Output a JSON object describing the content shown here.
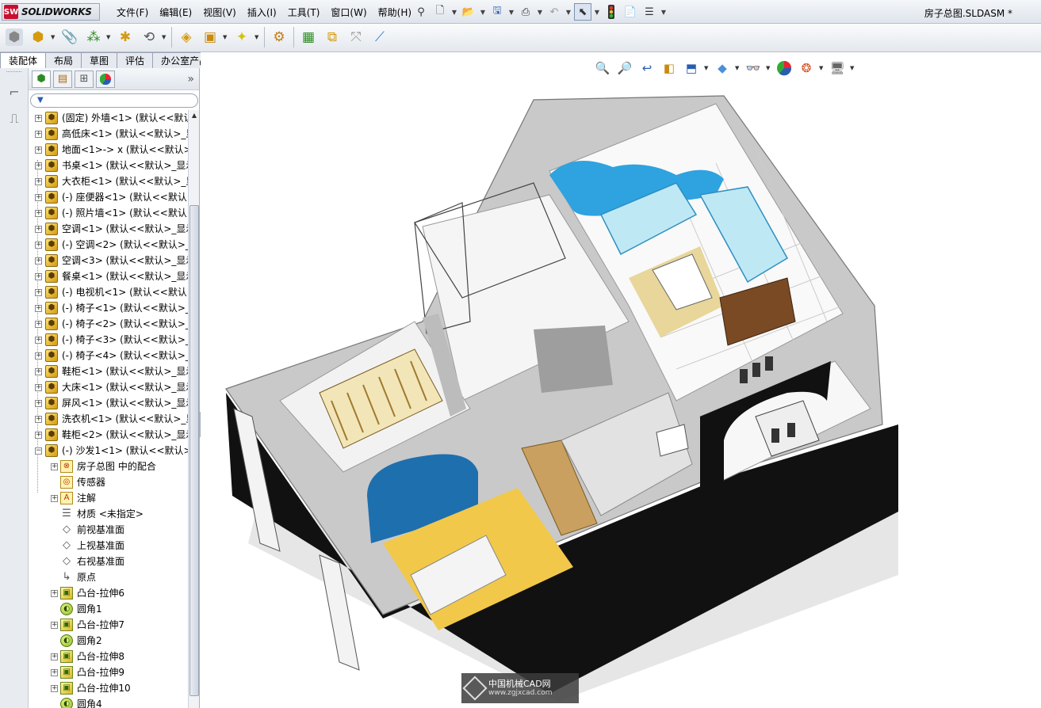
{
  "app": {
    "logo_badge": "SW",
    "logo_text": "SOLIDWORKS",
    "doc_title": "房子总图.SLDASM *"
  },
  "menu": [
    "文件(F)",
    "编辑(E)",
    "视图(V)",
    "插入(I)",
    "工具(T)",
    "窗口(W)",
    "帮助(H)"
  ],
  "quick_access": [
    "pin-icon",
    "new-icon",
    "open-icon",
    "save-icon",
    "print-icon",
    "undo-icon",
    "select-icon",
    "rebuild-icon",
    "file-properties-icon",
    "options-icon"
  ],
  "command_manager": [
    "insert-component-icon",
    "new-part-icon",
    "mate-icon",
    "linear-pattern-icon",
    "smart-fasteners-icon",
    "move-component-icon",
    "show-hidden-icon",
    "assembly-features-icon",
    "reference-geometry-icon",
    "new-motion-study-icon",
    "bill-of-materials-icon",
    "exploded-view-icon",
    "explode-line-sketch-icon",
    "interference-detection-icon"
  ],
  "tabs": [
    {
      "label": "装配体",
      "active": true
    },
    {
      "label": "布局",
      "active": false
    },
    {
      "label": "草图",
      "active": false
    },
    {
      "label": "评估",
      "active": false
    },
    {
      "label": "办公室产品",
      "active": false
    }
  ],
  "featuremanager": {
    "tabs": [
      "feature-manager-tab-icon",
      "property-manager-tab-icon",
      "configuration-manager-tab-icon",
      "display-manager-tab-icon"
    ],
    "more": "»",
    "filter_label": "▼",
    "components": [
      "(固定) 外墙<1> (默认<<默认",
      "高低床<1> (默认<<默认>_显",
      "地面<1>-> x (默认<<默认>_",
      "书桌<1> (默认<<默认>_显示",
      "大衣柜<1> (默认<<默认>_显",
      "(-) 座便器<1> (默认<<默认>",
      "(-) 照片墙<1> (默认<<默认>",
      "空调<1> (默认<<默认>_显示",
      "(-) 空调<2> (默认<<默认>_显",
      "空调<3> (默认<<默认>_显示",
      "餐桌<1> (默认<<默认>_显示",
      "(-) 电视机<1> (默认<<默认>",
      "(-) 椅子<1> (默认<<默认>_显",
      "(-) 椅子<2> (默认<<默认>_显",
      "(-) 椅子<3> (默认<<默认>_显",
      "(-) 椅子<4> (默认<<默认>_显",
      "鞋柜<1> (默认<<默认>_显示",
      "大床<1> (默认<<默认>_显示",
      "屏风<1> (默认<<默认>_显示",
      "洗衣机<1> (默认<<默认>_显",
      "鞋柜<2> (默认<<默认>_显示",
      "(-) 沙发1<1> (默认<<默认>_"
    ],
    "children": [
      {
        "label": "房子总图 中的配合",
        "icon": "mate-folder-icon",
        "expandable": true
      },
      {
        "label": "传感器",
        "icon": "sensor-icon",
        "expandable": false
      },
      {
        "label": "注解",
        "icon": "annotation-icon",
        "expandable": true
      },
      {
        "label": "材质 <未指定>",
        "icon": "material-icon",
        "expandable": false
      },
      {
        "label": "前视基准面",
        "icon": "plane-icon",
        "expandable": false
      },
      {
        "label": "上视基准面",
        "icon": "plane-icon",
        "expandable": false
      },
      {
        "label": "右视基准面",
        "icon": "plane-icon",
        "expandable": false
      },
      {
        "label": "原点",
        "icon": "origin-icon",
        "expandable": false
      },
      {
        "label": "凸台-拉伸6",
        "icon": "extrude-icon",
        "expandable": true
      },
      {
        "label": "圆角1",
        "icon": "fillet-icon",
        "expandable": false
      },
      {
        "label": "凸台-拉伸7",
        "icon": "extrude-icon",
        "expandable": true
      },
      {
        "label": "圆角2",
        "icon": "fillet-icon",
        "expandable": false
      },
      {
        "label": "凸台-拉伸8",
        "icon": "extrude-icon",
        "expandable": true
      },
      {
        "label": "凸台-拉伸9",
        "icon": "extrude-icon",
        "expandable": true
      },
      {
        "label": "凸台-拉伸10",
        "icon": "extrude-icon",
        "expandable": true
      },
      {
        "label": "圆角4",
        "icon": "fillet-icon",
        "expandable": false
      }
    ]
  },
  "heads_up_toolbar": [
    "zoom-to-fit-icon",
    "zoom-to-area-icon",
    "previous-view-icon",
    "section-view-icon",
    "view-orientation-icon",
    "display-style-icon",
    "hide-show-items-icon",
    "edit-appearance-icon",
    "apply-scene-icon",
    "view-settings-icon"
  ],
  "watermark": {
    "title": "中国机械CAD网",
    "url": "www.zgjxcad.com"
  },
  "colors": {
    "accent": "#2a5db0",
    "logo_red": "#c8102e",
    "wall_dark": "#111111",
    "wall_gray": "#c9c9c9",
    "floor_wood": "#f2c84b",
    "blue_furniture": "#1e6fae"
  }
}
